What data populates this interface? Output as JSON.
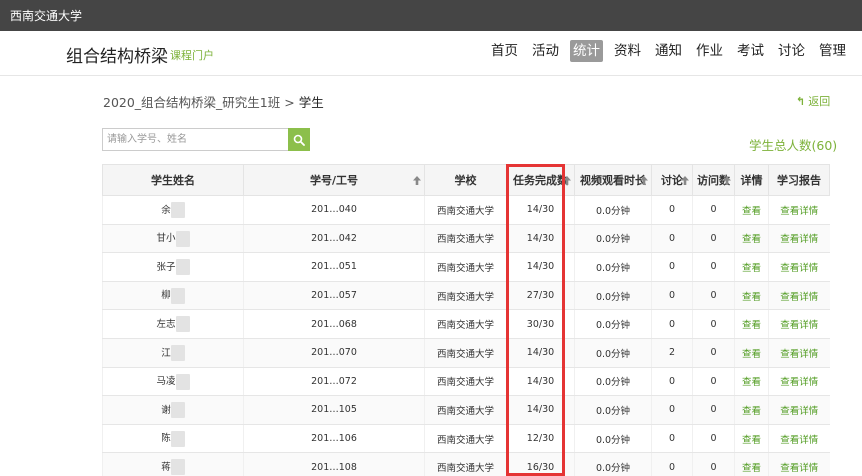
{
  "topbar": {
    "school": "西南交通大学"
  },
  "header": {
    "course_title": "组合结构桥梁",
    "course_sub": "课程门户",
    "nav": [
      {
        "label": "首页",
        "active": false
      },
      {
        "label": "活动",
        "active": false
      },
      {
        "label": "统计",
        "active": true
      },
      {
        "label": "资料",
        "active": false
      },
      {
        "label": "通知",
        "active": false
      },
      {
        "label": "作业",
        "active": false
      },
      {
        "label": "考试",
        "active": false
      },
      {
        "label": "讨论",
        "active": false
      },
      {
        "label": "管理",
        "active": false
      }
    ]
  },
  "breadcrumb": {
    "class_name": "2020_组合结构桥梁_研究生1班",
    "separator": " > ",
    "current": "学生"
  },
  "back_label": "返回",
  "search": {
    "placeholder": "请输入学号、姓名",
    "value": ""
  },
  "total_label": "学生总人数(60)",
  "accent_color": "#7db23a",
  "highlight_color": "#e53434",
  "table": {
    "columns": [
      "学生姓名",
      "学号/工号",
      "学校",
      "任务完成数",
      "视频观看时长",
      "讨论",
      "访问数",
      "详情",
      "学习报告"
    ],
    "rows": [
      {
        "name": "余",
        "id": "201…040",
        "school": "西南交通大学",
        "tasks": "14/30",
        "video": "0.0分钟",
        "discuss": "0",
        "visits": "0",
        "detail": "查看",
        "report": "查看详情"
      },
      {
        "name": "甘小",
        "id": "201…042",
        "school": "西南交通大学",
        "tasks": "14/30",
        "video": "0.0分钟",
        "discuss": "0",
        "visits": "0",
        "detail": "查看",
        "report": "查看详情"
      },
      {
        "name": "张子",
        "id": "201…051",
        "school": "西南交通大学",
        "tasks": "14/30",
        "video": "0.0分钟",
        "discuss": "0",
        "visits": "0",
        "detail": "查看",
        "report": "查看详情"
      },
      {
        "name": "柳",
        "id": "201…057",
        "school": "西南交通大学",
        "tasks": "27/30",
        "video": "0.0分钟",
        "discuss": "0",
        "visits": "0",
        "detail": "查看",
        "report": "查看详情"
      },
      {
        "name": "左志",
        "id": "201…068",
        "school": "西南交通大学",
        "tasks": "30/30",
        "video": "0.0分钟",
        "discuss": "0",
        "visits": "0",
        "detail": "查看",
        "report": "查看详情"
      },
      {
        "name": "江",
        "id": "201…070",
        "school": "西南交通大学",
        "tasks": "14/30",
        "video": "0.0分钟",
        "discuss": "2",
        "visits": "0",
        "detail": "查看",
        "report": "查看详情"
      },
      {
        "name": "马凌",
        "id": "201…072",
        "school": "西南交通大学",
        "tasks": "14/30",
        "video": "0.0分钟",
        "discuss": "0",
        "visits": "0",
        "detail": "查看",
        "report": "查看详情"
      },
      {
        "name": "谢",
        "id": "201…105",
        "school": "西南交通大学",
        "tasks": "14/30",
        "video": "0.0分钟",
        "discuss": "0",
        "visits": "0",
        "detail": "查看",
        "report": "查看详情"
      },
      {
        "name": "陈",
        "id": "201…106",
        "school": "西南交通大学",
        "tasks": "12/30",
        "video": "0.0分钟",
        "discuss": "0",
        "visits": "0",
        "detail": "查看",
        "report": "查看详情"
      },
      {
        "name": "蒋",
        "id": "201…108",
        "school": "西南交通大学",
        "tasks": "16/30",
        "video": "0.0分钟",
        "discuss": "0",
        "visits": "0",
        "detail": "查看",
        "report": "查看详情"
      }
    ]
  }
}
